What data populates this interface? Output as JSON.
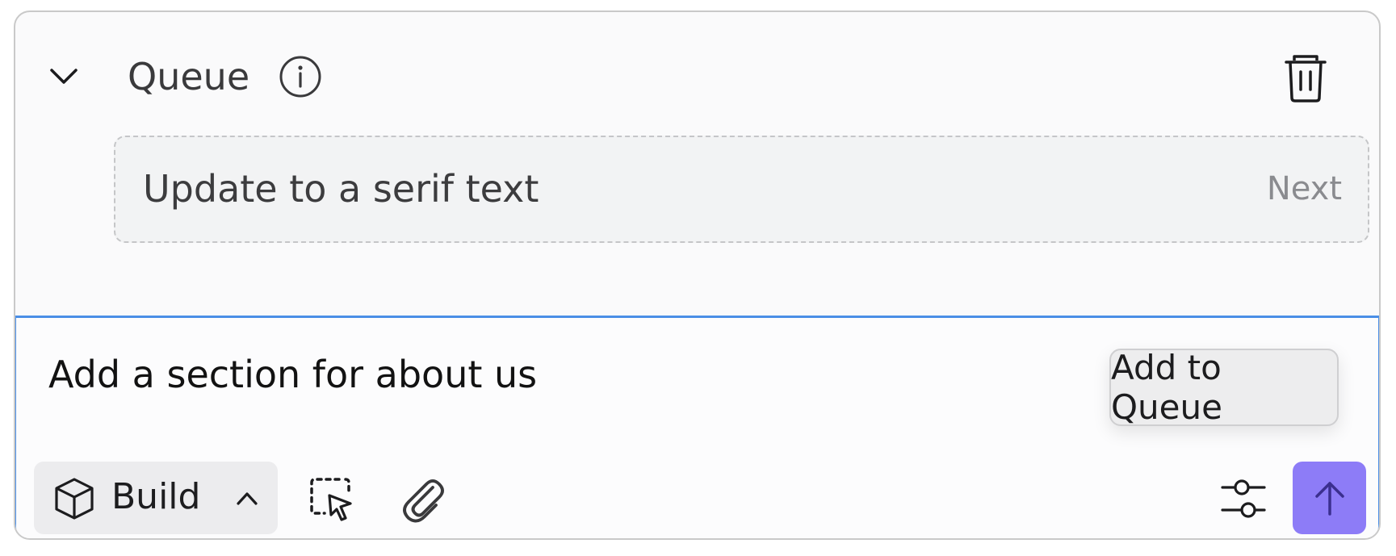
{
  "queue": {
    "title": "Queue",
    "items": [
      {
        "text": "Update to a serif text",
        "status": "Next"
      }
    ]
  },
  "composer": {
    "input_text": "Add a section for about us",
    "add_to_queue_label": "Add to Queue",
    "mode_label": "Build"
  },
  "icons": {
    "collapse": "chevron-down-icon",
    "info": "info-icon",
    "delete": "trash-icon",
    "mode": "cube-icon",
    "mode_toggle": "chevron-up-icon",
    "select_element": "select-element-icon",
    "attach": "paperclip-icon",
    "settings": "sliders-icon",
    "send": "arrow-up-icon"
  },
  "colors": {
    "accent_border": "#4a8ee6",
    "send_button": "#8d7cf7"
  }
}
